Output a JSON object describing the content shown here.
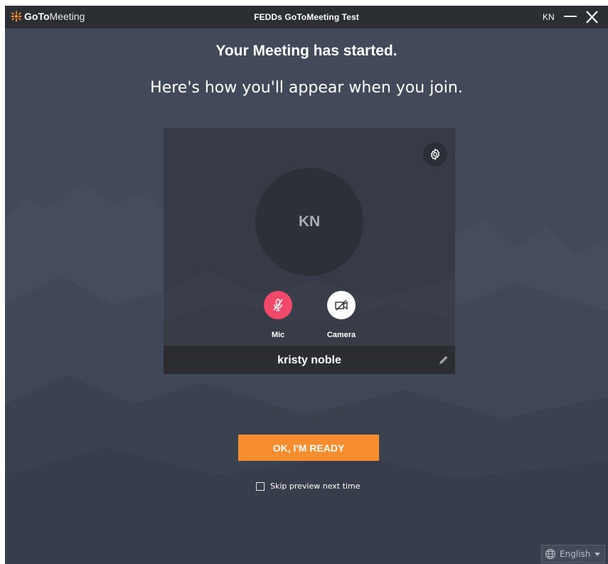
{
  "app": {
    "logo_bold": "GoTo",
    "logo_light": "Meeting",
    "window_title": "FEDDs GoToMeeting Test",
    "user_initials": "KN"
  },
  "main": {
    "heading": "Your Meeting has started.",
    "subheading": "Here's how you'll appear when you join."
  },
  "preview": {
    "avatar_initials": "KN",
    "mic_label": "Mic",
    "camera_label": "Camera",
    "mic_state": "muted",
    "camera_state": "off",
    "display_name": "kristy noble"
  },
  "actions": {
    "ready_label": "OK, I'M READY",
    "skip_preview_label": "Skip preview next time",
    "skip_preview_checked": false
  },
  "footer": {
    "language": "English"
  },
  "colors": {
    "background": "#424a5a",
    "titlebar": "#2b2e33",
    "accent_orange": "#f68d2e",
    "mic_muted": "#f0496a",
    "logo_orange": "#f68d2e"
  },
  "icons": [
    "goto-logo-icon",
    "close-icon",
    "gear-icon",
    "mic-off-icon",
    "camera-off-icon",
    "pencil-icon",
    "globe-icon",
    "chevron-down-icon"
  ]
}
